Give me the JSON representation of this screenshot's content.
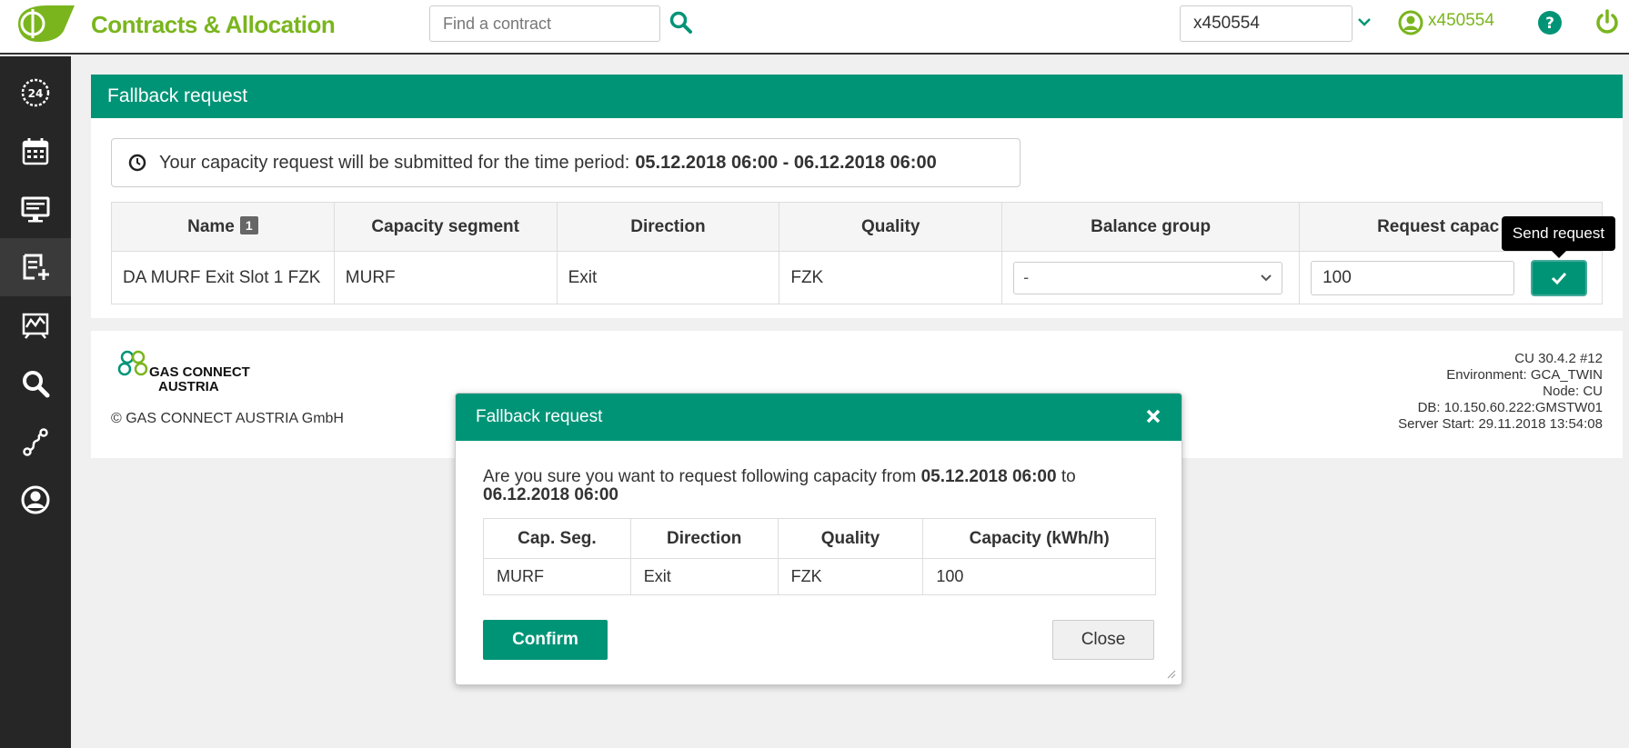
{
  "app": {
    "title": "Contracts & Allocation",
    "search_placeholder": "Find a contract",
    "selected_user": "x450554",
    "user_name": "x450554"
  },
  "colors": {
    "brand_green": "#7ab51d",
    "accent_teal": "#009477",
    "sidebar_bg": "#262626"
  },
  "sidebar": {
    "items": [
      {
        "icon": "clock-24-icon"
      },
      {
        "icon": "calendar-icon"
      },
      {
        "icon": "monitor-icon"
      },
      {
        "icon": "new-request-icon"
      },
      {
        "icon": "chart-report-icon"
      },
      {
        "icon": "search-icon"
      },
      {
        "icon": "route-icon"
      },
      {
        "icon": "user-circle-icon"
      }
    ]
  },
  "panel": {
    "title": "Fallback request",
    "info_prefix": "Your capacity request will be submitted for the time period:",
    "info_period": "05.12.2018 06:00 - 06.12.2018 06:00",
    "table": {
      "headers": {
        "name": "Name",
        "name_badge": "1",
        "capacity_segment": "Capacity segment",
        "direction": "Direction",
        "quality": "Quality",
        "balance_group": "Balance group",
        "request_capacity": "Request capac"
      },
      "row": {
        "name": "DA MURF Exit Slot 1 FZK",
        "capacity_segment": "MURF",
        "direction": "Exit",
        "quality": "FZK",
        "balance_group": "-",
        "request_capacity": "100"
      }
    },
    "send_tooltip": "Send request"
  },
  "footer": {
    "logo_line1": "GAS CONNECT",
    "logo_line2": "AUSTRIA",
    "copyright": "© GAS CONNECT AUSTRIA GmbH",
    "version": "CU 30.4.2 #12",
    "environment": "Environment: GCA_TWIN",
    "node": "Node: CU",
    "db": "DB: 10.150.60.222:GMSTW01",
    "server_start": "Server Start: 29.11.2018 13:54:08"
  },
  "modal": {
    "title": "Fallback request",
    "text_prefix": "Are you sure you want to request following capacity from",
    "from": "05.12.2018 06:00",
    "to_word": "to",
    "to": "06.12.2018 06:00",
    "table": {
      "headers": [
        "Cap. Seg.",
        "Direction",
        "Quality",
        "Capacity (kWh/h)"
      ],
      "row": [
        "MURF",
        "Exit",
        "FZK",
        "100"
      ]
    },
    "confirm_label": "Confirm",
    "close_label": "Close"
  }
}
